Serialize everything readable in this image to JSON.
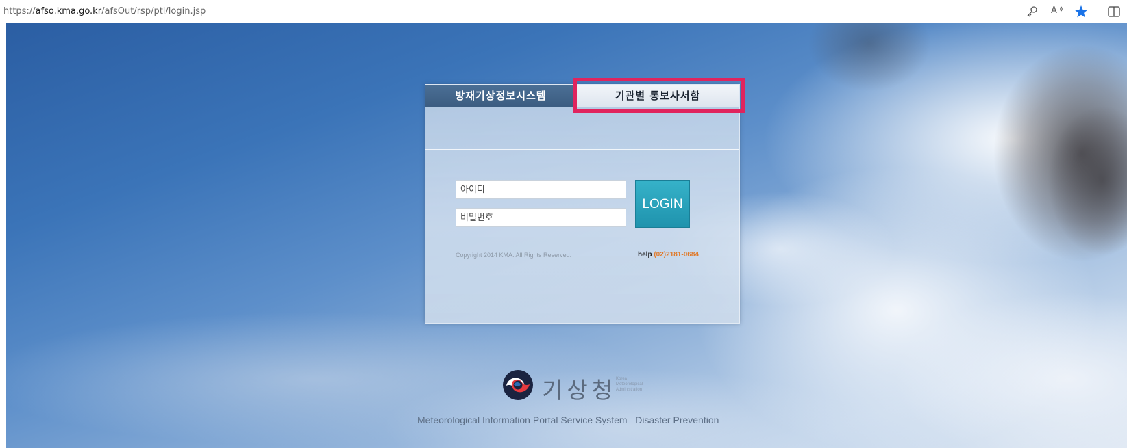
{
  "browser": {
    "url_scheme": "https://",
    "url_host": "afso.kma.go.kr",
    "url_path": "/afsOut/rsp/ptl/login.jsp",
    "icons": [
      "key-icon",
      "read-aloud-icon",
      "favorite-star-icon",
      "split-screen-icon"
    ],
    "read_aloud_text": "A",
    "favorite_color": "#1a73e8"
  },
  "login": {
    "tabs": [
      {
        "label": "방재기상정보시스템",
        "active": true
      },
      {
        "label": "기관별 통보사서함",
        "active": false,
        "highlighted": true
      }
    ],
    "id_placeholder": "아이디",
    "password_placeholder": "비밀번호",
    "login_button": "LOGIN",
    "copyright": "Copyright 2014 KMA. All Rights Reserved.",
    "help_label": "help",
    "help_phone": "(02)2181-0684"
  },
  "footer": {
    "logo_korean": "기상청",
    "logo_english_1": "Korea",
    "logo_english_2": "Meteorological",
    "logo_english_3": "Administration",
    "title": "Meteorological Information Portal Service System_ Disaster Prevention"
  },
  "colors": {
    "highlight_border": "#e0245e",
    "login_button": "#2aa3bc",
    "help_phone": "#e07a2a"
  }
}
